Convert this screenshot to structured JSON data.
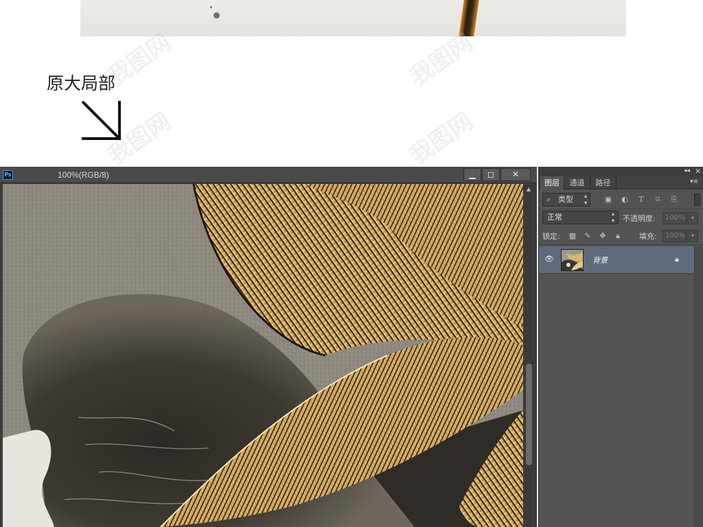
{
  "caption": {
    "text": "原大局部"
  },
  "watermark": {
    "text": "我图网"
  },
  "document": {
    "app_badge": "Ps",
    "title": "100%(RGB/8)",
    "buttons": {
      "minimize": "▁",
      "maximize": "◻",
      "close": "✕"
    }
  },
  "layers_panel": {
    "header": {
      "collapse": "◂◂",
      "close": "✕",
      "menu": "▾≡"
    },
    "tabs": [
      {
        "label": "图层",
        "active": true
      },
      {
        "label": "通道",
        "active": false
      },
      {
        "label": "路径",
        "active": false
      }
    ],
    "filter": {
      "search_glyph": "⌕",
      "kind_label": "类型",
      "icons": [
        "image-filter-icon",
        "adjustment-filter-icon",
        "type-filter-icon",
        "shape-filter-icon",
        "smartobject-filter-icon"
      ]
    },
    "blend_mode": "正常",
    "opacity_label": "不透明度:",
    "opacity_value": "100%",
    "lock_label": "锁定:",
    "lock_icons": [
      "lock-transparent-icon",
      "lock-paint-icon",
      "lock-move-icon",
      "lock-all-icon"
    ],
    "fill_label": "填充:",
    "fill_value": "100%",
    "layers": [
      {
        "name": "背景",
        "visible": true,
        "locked": true,
        "selected": true
      }
    ]
  },
  "colors": {
    "panel_bg": "#535353",
    "selected_layer": "#5f6a7a",
    "gold": "#d4b06a",
    "concrete": "#8d887e",
    "ink": "#3a352e"
  }
}
